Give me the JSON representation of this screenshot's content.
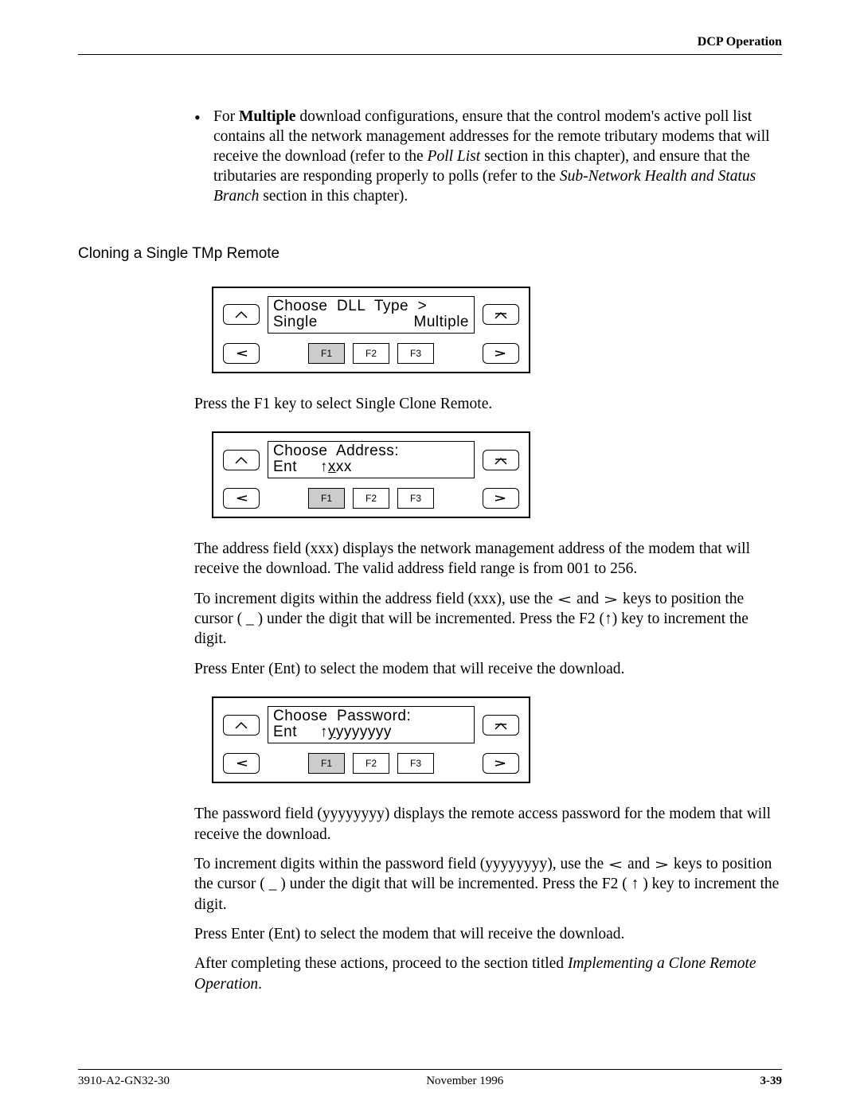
{
  "header": {
    "section": "DCP Operation"
  },
  "bullet": {
    "prefix": "For ",
    "bold": "Multiple",
    "rest_a": " download configurations, ensure that the control modem's active poll list contains all the network management addresses for the remote tributary modems that will receive the download (refer to the ",
    "ital_a": "Poll List",
    "rest_b": " section in this chapter), and ensure that the tributaries are responding properly to polls (refer to the ",
    "ital_b": "Sub-Network Health and Status Branch",
    "rest_c": " section in this chapter)."
  },
  "heading": "Cloning a Single TMp Remote",
  "panel1": {
    "line1": "Choose  DLL  Type  >",
    "line2_left": "Single",
    "line2_right": "Multiple",
    "f1": "F1",
    "f2": "F2",
    "f3": "F3"
  },
  "p1": "Press the F1 key to select Single Clone Remote.",
  "panel2": {
    "line1": "Choose  Address:",
    "line2_a": "Ent     ↑",
    "line2_u": "x",
    "line2_b": "xx",
    "f1": "F1",
    "f2": "F2",
    "f3": "F3"
  },
  "p2": "The address field (xxx) displays the network management address of the modem that will receive the download. The valid address field range is from 001 to 256.",
  "p3_a": "To increment digits within the address field (xxx), use the ",
  "p3_b": " and ",
  "p3_c": " keys to position the cursor ( _ ) under the digit that will be incremented. Press the F2 (↑) key to increment the digit.",
  "p4": "Press Enter (Ent) to select the modem that will receive the download.",
  "panel3": {
    "line1": "Choose  Password:",
    "line2_a": "Ent     ↑",
    "line2_u": "y",
    "line2_b": "yyyyyyy",
    "f1": "F1",
    "f2": "F2",
    "f3": "F3"
  },
  "p5": "The password field (yyyyyyyy) displays the remote access password for the modem that will receive the download.",
  "p6_a": "To increment digits within the password field (yyyyyyyy), use the ",
  "p6_b": " and ",
  "p6_c": " keys to position the cursor ( _ ) under the digit that will be incremented. Press the F2 ( ↑ ) key to increment the digit.",
  "p7": "Press Enter (Ent) to select the modem that will receive the download.",
  "p8_a": "After completing these actions, proceed to the section titled ",
  "p8_i": "Implementing a Clone Remote Operation",
  "p8_b": ".",
  "footer": {
    "left": "3910-A2-GN32-30",
    "center": "November 1996",
    "right": "3-39"
  }
}
